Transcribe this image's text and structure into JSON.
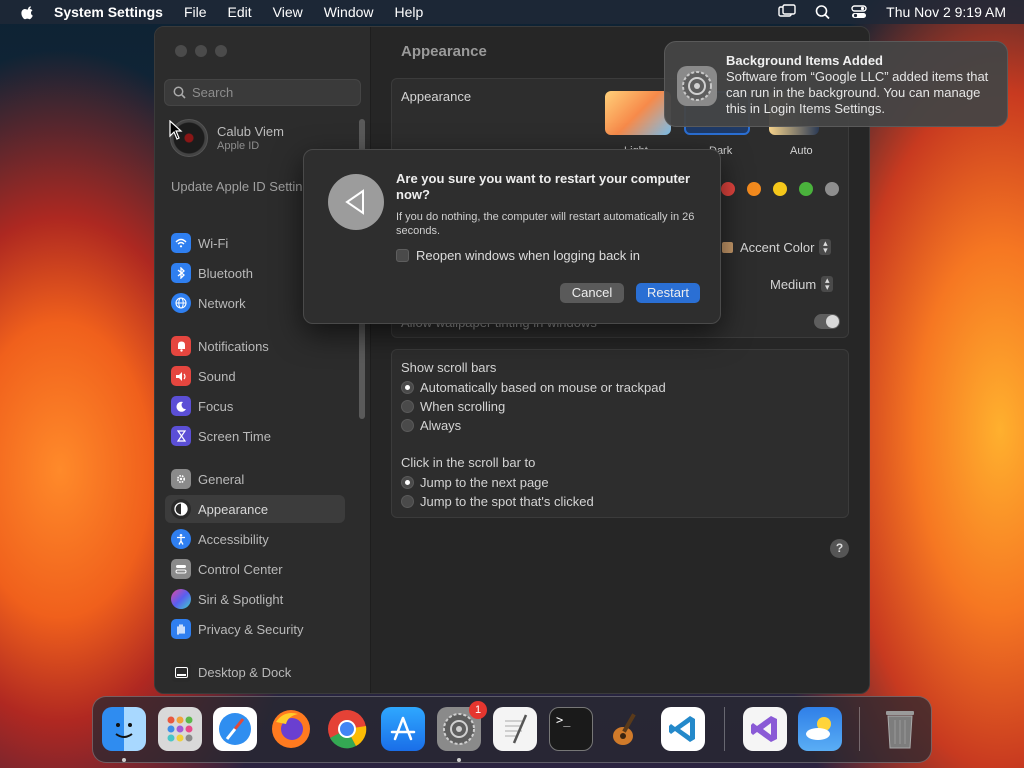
{
  "menubar": {
    "app_name": "System Settings",
    "menus": [
      "File",
      "Edit",
      "View",
      "Window",
      "Help"
    ],
    "clock": "Thu Nov 2  9:19 AM"
  },
  "sidebar": {
    "search_placeholder": "Search",
    "user": {
      "name": "Calub Viem",
      "sub": "Apple ID"
    },
    "update_text": "Update Apple ID Settings",
    "items": [
      {
        "label": "Wi-Fi",
        "icon": "wifi-icon",
        "color": "#2f7ff0"
      },
      {
        "label": "Bluetooth",
        "icon": "bluetooth-icon",
        "color": "#2f7ff0"
      },
      {
        "label": "Network",
        "icon": "globe-icon",
        "color": "#2f7ff0"
      },
      {
        "label": "Notifications",
        "icon": "bell-icon",
        "color": "#e5463f"
      },
      {
        "label": "Sound",
        "icon": "speaker-icon",
        "color": "#e5463f"
      },
      {
        "label": "Focus",
        "icon": "moon-icon",
        "color": "#5b4fd6"
      },
      {
        "label": "Screen Time",
        "icon": "hourglass-icon",
        "color": "#5b4fd6"
      },
      {
        "label": "General",
        "icon": "gear-icon",
        "color": "#8a8a8a"
      },
      {
        "label": "Appearance",
        "icon": "appearance-icon",
        "color": "#2a2a2a"
      },
      {
        "label": "Accessibility",
        "icon": "accessibility-icon",
        "color": "#2f7ff0"
      },
      {
        "label": "Control Center",
        "icon": "control-center-icon",
        "color": "#8a8a8a"
      },
      {
        "label": "Siri & Spotlight",
        "icon": "siri-icon",
        "color": "#b044d8"
      },
      {
        "label": "Privacy & Security",
        "icon": "hand-icon",
        "color": "#2f7ff0"
      },
      {
        "label": "Desktop & Dock",
        "icon": "dock-icon",
        "color": "#2a2a2a"
      }
    ]
  },
  "content": {
    "page_title": "Appearance",
    "appearance_label": "Appearance",
    "modes": [
      "Light",
      "Dark",
      "Auto"
    ],
    "accent_colors": [
      "#e5453f",
      "#f28a1e",
      "#f5c71a",
      "#4ab23c",
      "#8e8e8e"
    ],
    "accent_color_label": "Accent Color",
    "sidebar_size_value": "Medium",
    "wallpaper_tint_label": "Allow wallpaper tinting in windows",
    "scroll_bars_label": "Show scroll bars",
    "scroll_options": [
      "Automatically based on mouse or trackpad",
      "When scrolling",
      "Always"
    ],
    "click_label": "Click in the scroll bar to",
    "click_options": [
      "Jump to the next page",
      "Jump to the spot that's clicked"
    ],
    "help": "?"
  },
  "dialog": {
    "title": "Are you sure you want to restart your computer now?",
    "message": "If you do nothing, the computer will restart automatically in 26 seconds.",
    "checkbox_label": "Reopen windows when logging back in",
    "cancel": "Cancel",
    "restart": "Restart"
  },
  "notification": {
    "title": "Background Items Added",
    "body": "Software from “Google LLC” added items that can run in the background. You can manage this in Login Items Settings."
  },
  "dock": {
    "apps": [
      "finder-icon",
      "launchpad-icon",
      "safari-icon",
      "firefox-icon",
      "chrome-icon",
      "app-store-icon",
      "system-settings-icon",
      "textedit-icon",
      "terminal-icon",
      "garageband-icon",
      "vscode-icon",
      "visual-studio-icon",
      "weather-icon",
      "trash-icon"
    ],
    "settings_badge": "1"
  }
}
